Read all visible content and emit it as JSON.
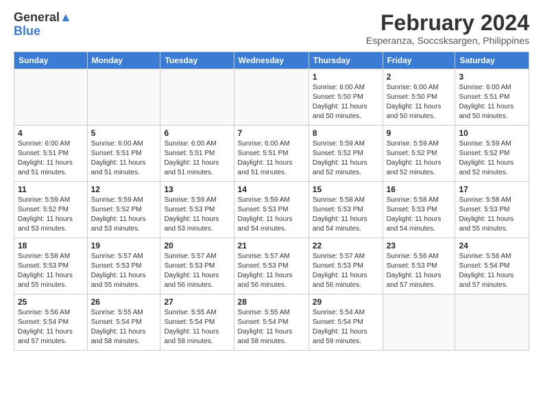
{
  "logo": {
    "line1": "General",
    "line2": "Blue"
  },
  "title": "February 2024",
  "subtitle": "Esperanza, Soccsksargen, Philippines",
  "headers": [
    "Sunday",
    "Monday",
    "Tuesday",
    "Wednesday",
    "Thursday",
    "Friday",
    "Saturday"
  ],
  "weeks": [
    [
      {
        "day": "",
        "info": ""
      },
      {
        "day": "",
        "info": ""
      },
      {
        "day": "",
        "info": ""
      },
      {
        "day": "",
        "info": ""
      },
      {
        "day": "1",
        "info": "Sunrise: 6:00 AM\nSunset: 5:50 PM\nDaylight: 11 hours\nand 50 minutes."
      },
      {
        "day": "2",
        "info": "Sunrise: 6:00 AM\nSunset: 5:50 PM\nDaylight: 11 hours\nand 50 minutes."
      },
      {
        "day": "3",
        "info": "Sunrise: 6:00 AM\nSunset: 5:51 PM\nDaylight: 11 hours\nand 50 minutes."
      }
    ],
    [
      {
        "day": "4",
        "info": "Sunrise: 6:00 AM\nSunset: 5:51 PM\nDaylight: 11 hours\nand 51 minutes."
      },
      {
        "day": "5",
        "info": "Sunrise: 6:00 AM\nSunset: 5:51 PM\nDaylight: 11 hours\nand 51 minutes."
      },
      {
        "day": "6",
        "info": "Sunrise: 6:00 AM\nSunset: 5:51 PM\nDaylight: 11 hours\nand 51 minutes."
      },
      {
        "day": "7",
        "info": "Sunrise: 6:00 AM\nSunset: 5:51 PM\nDaylight: 11 hours\nand 51 minutes."
      },
      {
        "day": "8",
        "info": "Sunrise: 5:59 AM\nSunset: 5:52 PM\nDaylight: 11 hours\nand 52 minutes."
      },
      {
        "day": "9",
        "info": "Sunrise: 5:59 AM\nSunset: 5:52 PM\nDaylight: 11 hours\nand 52 minutes."
      },
      {
        "day": "10",
        "info": "Sunrise: 5:59 AM\nSunset: 5:52 PM\nDaylight: 11 hours\nand 52 minutes."
      }
    ],
    [
      {
        "day": "11",
        "info": "Sunrise: 5:59 AM\nSunset: 5:52 PM\nDaylight: 11 hours\nand 53 minutes."
      },
      {
        "day": "12",
        "info": "Sunrise: 5:59 AM\nSunset: 5:52 PM\nDaylight: 11 hours\nand 53 minutes."
      },
      {
        "day": "13",
        "info": "Sunrise: 5:59 AM\nSunset: 5:53 PM\nDaylight: 11 hours\nand 53 minutes."
      },
      {
        "day": "14",
        "info": "Sunrise: 5:59 AM\nSunset: 5:53 PM\nDaylight: 11 hours\nand 54 minutes."
      },
      {
        "day": "15",
        "info": "Sunrise: 5:58 AM\nSunset: 5:53 PM\nDaylight: 11 hours\nand 54 minutes."
      },
      {
        "day": "16",
        "info": "Sunrise: 5:58 AM\nSunset: 5:53 PM\nDaylight: 11 hours\nand 54 minutes."
      },
      {
        "day": "17",
        "info": "Sunrise: 5:58 AM\nSunset: 5:53 PM\nDaylight: 11 hours\nand 55 minutes."
      }
    ],
    [
      {
        "day": "18",
        "info": "Sunrise: 5:58 AM\nSunset: 5:53 PM\nDaylight: 11 hours\nand 55 minutes."
      },
      {
        "day": "19",
        "info": "Sunrise: 5:57 AM\nSunset: 5:53 PM\nDaylight: 11 hours\nand 55 minutes."
      },
      {
        "day": "20",
        "info": "Sunrise: 5:57 AM\nSunset: 5:53 PM\nDaylight: 11 hours\nand 56 minutes."
      },
      {
        "day": "21",
        "info": "Sunrise: 5:57 AM\nSunset: 5:53 PM\nDaylight: 11 hours\nand 56 minutes."
      },
      {
        "day": "22",
        "info": "Sunrise: 5:57 AM\nSunset: 5:53 PM\nDaylight: 11 hours\nand 56 minutes."
      },
      {
        "day": "23",
        "info": "Sunrise: 5:56 AM\nSunset: 5:53 PM\nDaylight: 11 hours\nand 57 minutes."
      },
      {
        "day": "24",
        "info": "Sunrise: 5:56 AM\nSunset: 5:54 PM\nDaylight: 11 hours\nand 57 minutes."
      }
    ],
    [
      {
        "day": "25",
        "info": "Sunrise: 5:56 AM\nSunset: 5:54 PM\nDaylight: 11 hours\nand 57 minutes."
      },
      {
        "day": "26",
        "info": "Sunrise: 5:55 AM\nSunset: 5:54 PM\nDaylight: 11 hours\nand 58 minutes."
      },
      {
        "day": "27",
        "info": "Sunrise: 5:55 AM\nSunset: 5:54 PM\nDaylight: 11 hours\nand 58 minutes."
      },
      {
        "day": "28",
        "info": "Sunrise: 5:55 AM\nSunset: 5:54 PM\nDaylight: 11 hours\nand 58 minutes."
      },
      {
        "day": "29",
        "info": "Sunrise: 5:54 AM\nSunset: 5:54 PM\nDaylight: 11 hours\nand 59 minutes."
      },
      {
        "day": "",
        "info": ""
      },
      {
        "day": "",
        "info": ""
      }
    ]
  ]
}
